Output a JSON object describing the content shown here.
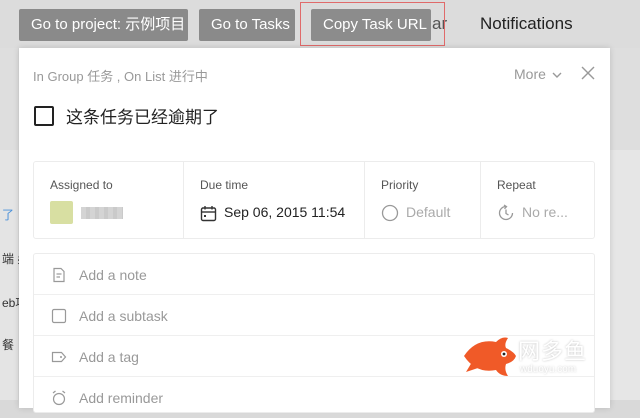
{
  "top_bar": {
    "project_button": "Go to project: 示例项目",
    "tasks_button": "Go to Tasks",
    "copy_url_button": "Copy Task URL",
    "fragment_ar": "ar",
    "notifications": "Notifications"
  },
  "background_fragments": [
    "了",
    "端 桑",
    "eb项",
    "餐"
  ],
  "modal": {
    "breadcrumb": "In Group 任务 , On List 进行中",
    "more_label": "More",
    "task_title": "这条任务已经逾期了",
    "meta": {
      "assigned_label": "Assigned to",
      "due_label": "Due time",
      "due_value": "Sep 06, 2015 11:54",
      "priority_label": "Priority",
      "priority_value": "Default",
      "repeat_label": "Repeat",
      "repeat_value": "No re..."
    },
    "fields": {
      "note": "Add a note",
      "subtask": "Add a subtask",
      "tag": "Add a tag",
      "reminder": "Add reminder"
    }
  },
  "watermark": {
    "text": "网多鱼",
    "sub": "wduoyu.com",
    "color": "#f05a28"
  }
}
